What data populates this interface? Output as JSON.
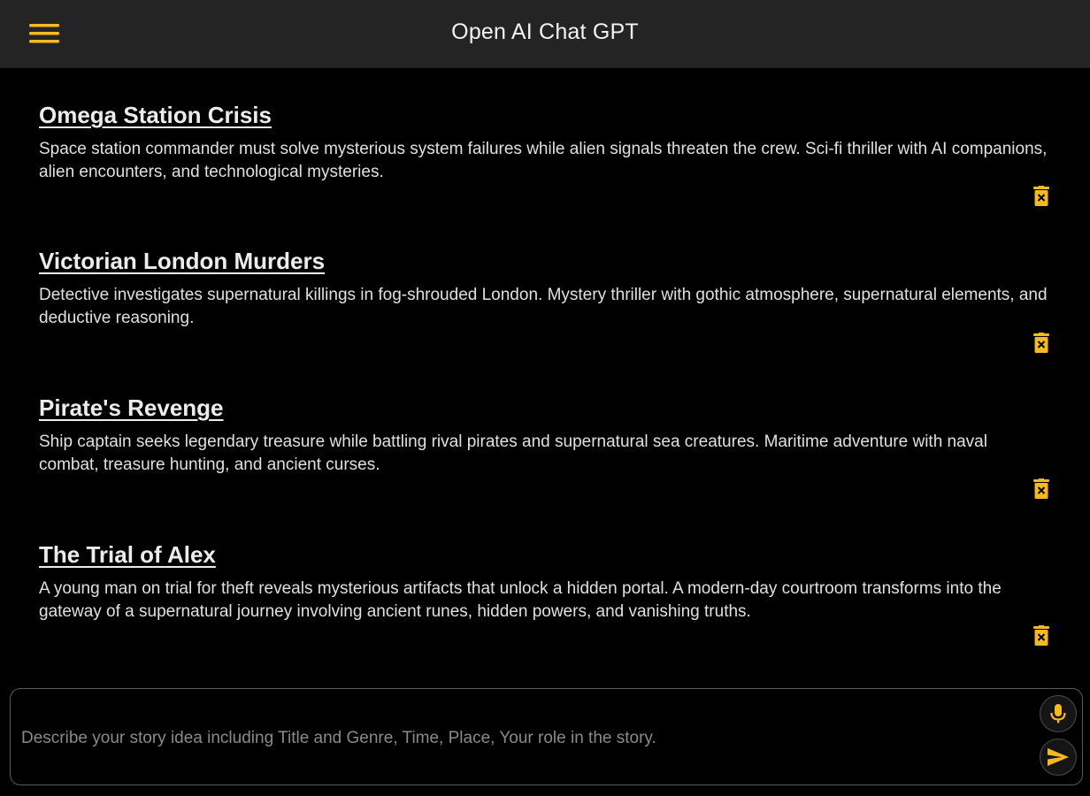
{
  "header": {
    "title": "Open AI Chat GPT",
    "menu_icon": "hamburger-menu-icon"
  },
  "colors": {
    "background": "#000000",
    "header_bg": "#242424",
    "accent": "#f5b921",
    "text": "#e6e6e6",
    "border": "#5a5a5a"
  },
  "stories": [
    {
      "title": "Omega Station Crisis",
      "description": "Space station commander must solve mysterious system failures while alien signals threaten the crew. Sci-fi thriller with AI companions, alien encounters, and technological mysteries.",
      "action_icon": "trash-icon"
    },
    {
      "title": "Victorian London Murders",
      "description": "Detective investigates supernatural killings in fog-shrouded London. Mystery thriller with gothic atmosphere, supernatural elements, and deductive reasoning.",
      "action_icon": "trash-icon"
    },
    {
      "title": "Pirate's Revenge",
      "description": "Ship captain seeks legendary treasure while battling rival pirates and supernatural sea creatures. Maritime adventure with naval combat, treasure hunting, and ancient curses.",
      "action_icon": "trash-icon"
    },
    {
      "title": "The Trial of Alex",
      "description": "A young man on trial for theft reveals mysterious artifacts that unlock a hidden portal. A modern-day courtroom transforms into the gateway of a supernatural journey involving ancient runes, hidden powers, and vanishing truths.",
      "action_icon": "trash-icon"
    }
  ],
  "composer": {
    "value": "",
    "placeholder": "Describe your story idea including Title and Genre, Time, Place, Your role in the story.",
    "mic_icon": "microphone-icon",
    "send_icon": "send-icon"
  }
}
